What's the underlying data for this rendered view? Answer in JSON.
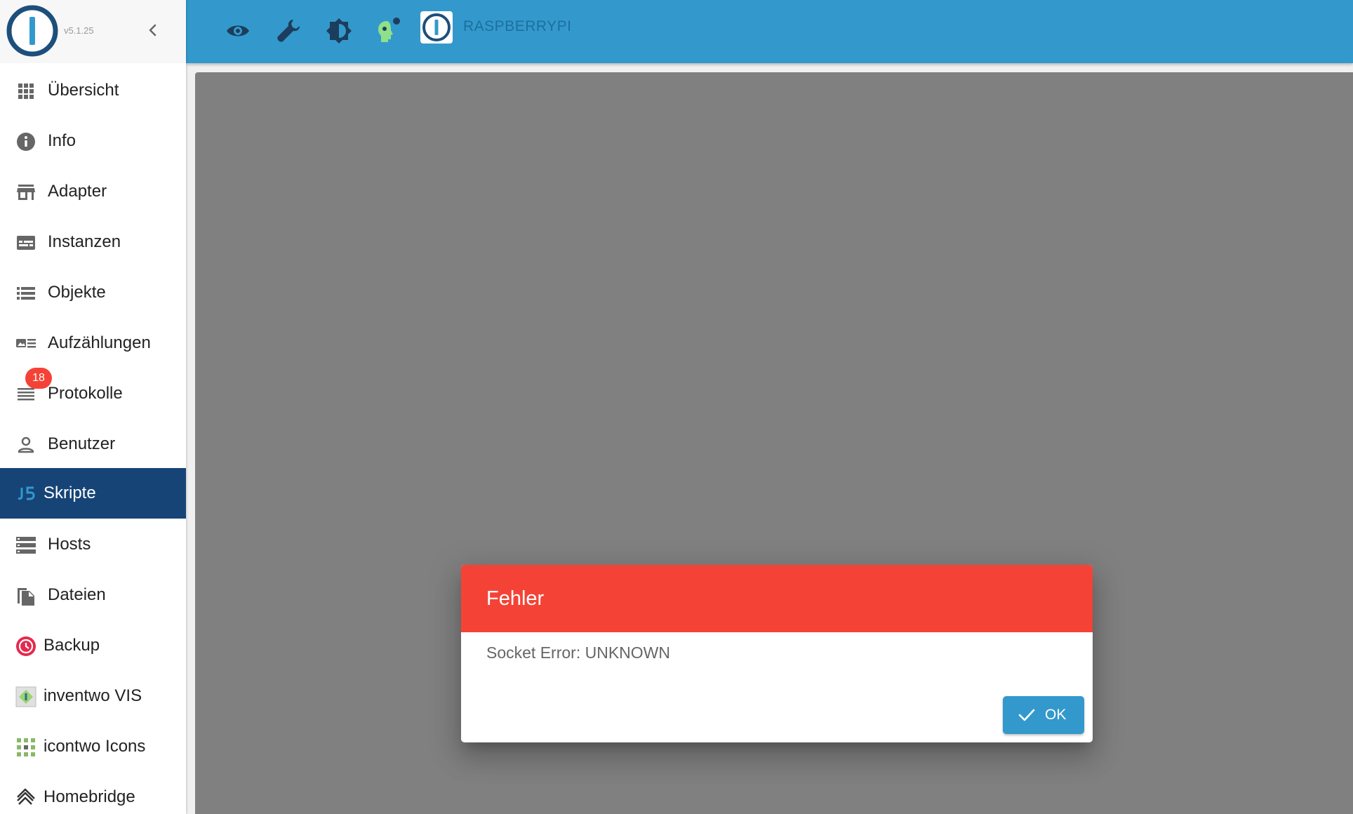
{
  "app": {
    "version": "v5.1.25"
  },
  "sidebar": {
    "items": [
      {
        "label": "Übersicht",
        "icon": "grid-icon"
      },
      {
        "label": "Info",
        "icon": "info-icon"
      },
      {
        "label": "Adapter",
        "icon": "store-icon"
      },
      {
        "label": "Instanzen",
        "icon": "instances-icon"
      },
      {
        "label": "Objekte",
        "icon": "list-icon"
      },
      {
        "label": "Aufzählungen",
        "icon": "enums-icon"
      },
      {
        "label": "Protokolle",
        "icon": "log-icon",
        "badge": "18"
      },
      {
        "label": "Benutzer",
        "icon": "user-icon"
      },
      {
        "label": "Skripte",
        "icon": "javascript-icon",
        "active": true
      },
      {
        "label": "Hosts",
        "icon": "server-icon"
      },
      {
        "label": "Dateien",
        "icon": "files-icon"
      },
      {
        "label": "Backup",
        "icon": "backup-icon"
      },
      {
        "label": "inventwo VIS",
        "icon": "inventwo-icon"
      },
      {
        "label": "icontwo Icons",
        "icon": "icontwo-icon"
      },
      {
        "label": "Homebridge",
        "icon": "homebridge-icon"
      }
    ]
  },
  "topbar": {
    "host_name": "RASPBERRYPI",
    "buttons": [
      "eye-icon",
      "wrench-icon",
      "brightness-icon",
      "expert-mode-icon"
    ]
  },
  "dialog": {
    "title": "Fehler",
    "message": "Socket Error: UNKNOWN",
    "ok_label": "OK"
  },
  "colors": {
    "topbar": "#3399cc",
    "active_item": "#164477",
    "dialog_header": "#f44336",
    "badge": "#f44336",
    "overlay": "#808080"
  }
}
